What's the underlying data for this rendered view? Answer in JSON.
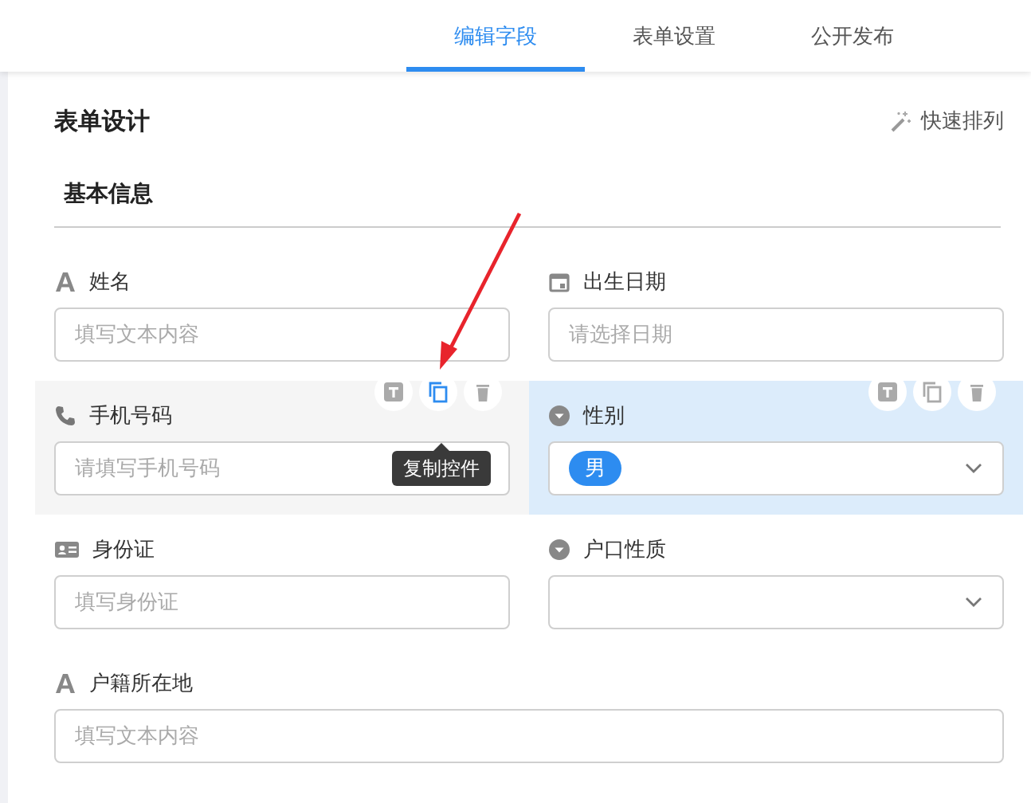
{
  "tabs": [
    {
      "label": "编辑字段",
      "selected": true
    },
    {
      "label": "表单设置",
      "selected": false
    },
    {
      "label": "公开发布",
      "selected": false
    }
  ],
  "panel": {
    "title": "表单设计",
    "quick_sort": "快速排列"
  },
  "section": {
    "title": "基本信息",
    "fields": [
      {
        "kind": "text",
        "label": "姓名",
        "placeholder": "填写文本内容",
        "hovered": false,
        "selected": false,
        "full_width": false
      },
      {
        "kind": "date",
        "label": "出生日期",
        "placeholder": "请选择日期",
        "hovered": false,
        "selected": false,
        "full_width": false
      },
      {
        "kind": "phone",
        "label": "手机号码",
        "placeholder": "请填写手机号码",
        "hovered": true,
        "selected": false,
        "full_width": false,
        "tooltip": "复制控件"
      },
      {
        "kind": "select",
        "label": "性别",
        "value": "男",
        "hovered": false,
        "selected": true,
        "full_width": false
      },
      {
        "kind": "id",
        "label": "身份证",
        "placeholder": "填写身份证",
        "hovered": false,
        "selected": false,
        "full_width": false
      },
      {
        "kind": "select",
        "label": "户口性质",
        "hovered": false,
        "selected": false,
        "full_width": false
      },
      {
        "kind": "text",
        "label": "户籍所在地",
        "placeholder": "填写文本内容",
        "hovered": false,
        "selected": false,
        "full_width": true
      }
    ]
  }
}
